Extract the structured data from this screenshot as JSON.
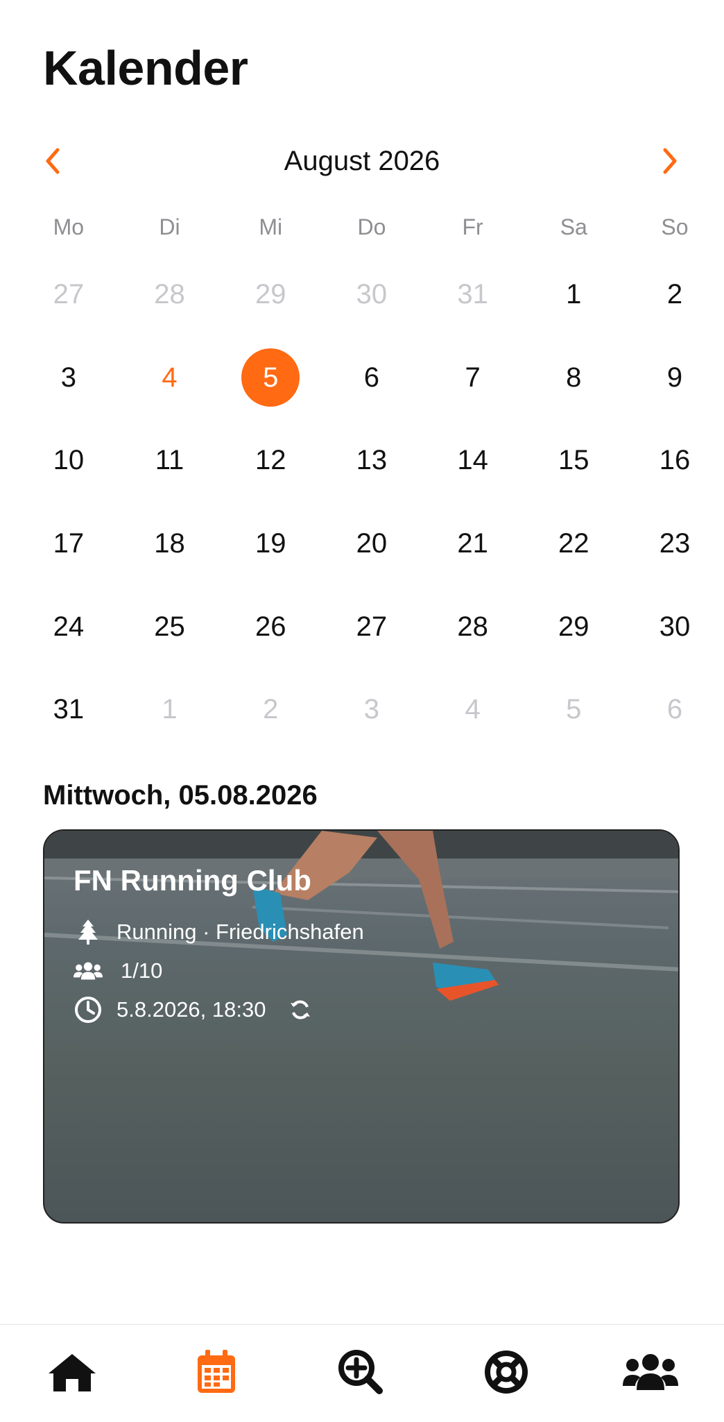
{
  "header": {
    "title": "Kalender"
  },
  "calendar": {
    "month_label": "August 2026",
    "weekdays": [
      "Mo",
      "Di",
      "Mi",
      "Do",
      "Fr",
      "Sa",
      "So"
    ],
    "days": [
      {
        "d": "27",
        "muted": true
      },
      {
        "d": "28",
        "muted": true
      },
      {
        "d": "29",
        "muted": true
      },
      {
        "d": "30",
        "muted": true
      },
      {
        "d": "31",
        "muted": true
      },
      {
        "d": "1"
      },
      {
        "d": "2"
      },
      {
        "d": "3"
      },
      {
        "d": "4",
        "today": true
      },
      {
        "d": "5",
        "selected": true
      },
      {
        "d": "6"
      },
      {
        "d": "7"
      },
      {
        "d": "8"
      },
      {
        "d": "9"
      },
      {
        "d": "10"
      },
      {
        "d": "11"
      },
      {
        "d": "12"
      },
      {
        "d": "13"
      },
      {
        "d": "14"
      },
      {
        "d": "15"
      },
      {
        "d": "16"
      },
      {
        "d": "17"
      },
      {
        "d": "18"
      },
      {
        "d": "19"
      },
      {
        "d": "20"
      },
      {
        "d": "21"
      },
      {
        "d": "22"
      },
      {
        "d": "23"
      },
      {
        "d": "24"
      },
      {
        "d": "25"
      },
      {
        "d": "26"
      },
      {
        "d": "27"
      },
      {
        "d": "28"
      },
      {
        "d": "29"
      },
      {
        "d": "30"
      },
      {
        "d": "31"
      },
      {
        "d": "1",
        "muted": true
      },
      {
        "d": "2",
        "muted": true
      },
      {
        "d": "3",
        "muted": true
      },
      {
        "d": "4",
        "muted": true
      },
      {
        "d": "5",
        "muted": true
      },
      {
        "d": "6",
        "muted": true
      }
    ]
  },
  "selected_day": {
    "heading": "Mittwoch, 05.08.2026"
  },
  "event": {
    "title": "FN Running Club",
    "category_location": "Running · Friedrichshafen",
    "participants": "1/10",
    "datetime": "5.8.2026, 18:30"
  },
  "tabs": [
    {
      "icon": "home-icon",
      "active": false
    },
    {
      "icon": "calendar-icon",
      "active": true
    },
    {
      "icon": "search-plus-icon",
      "active": false
    },
    {
      "icon": "lifebuoy-icon",
      "active": false
    },
    {
      "icon": "users-icon",
      "active": false
    }
  ],
  "colors": {
    "accent": "#ff6a13",
    "muted": "#c7c7cc",
    "weekday": "#8e8e93",
    "text": "#111111"
  }
}
